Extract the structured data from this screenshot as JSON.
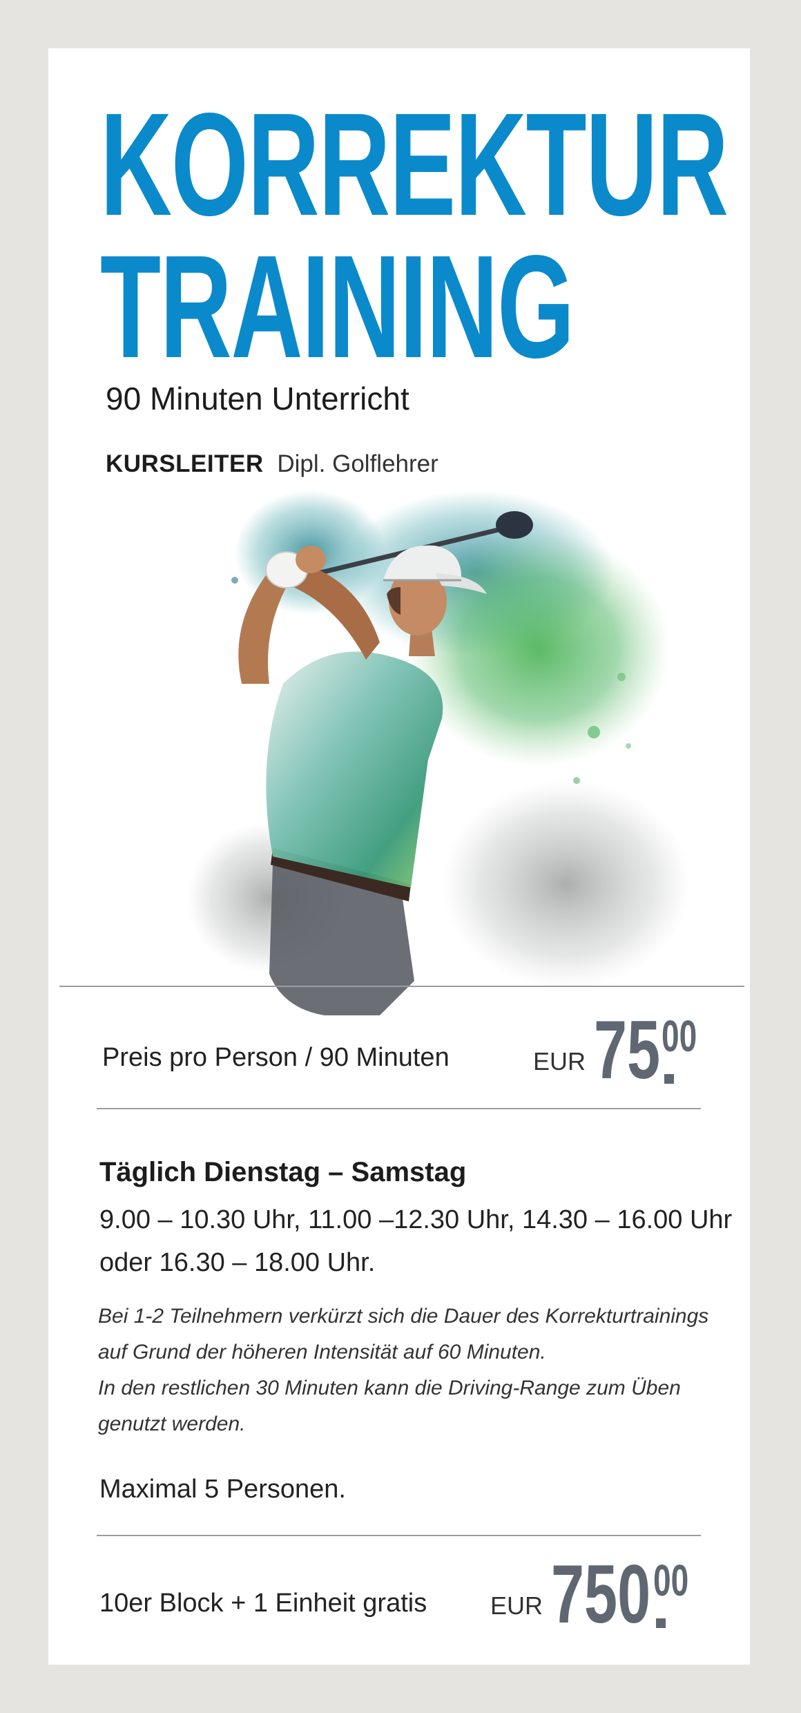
{
  "title": {
    "line1": "KORREKTUR",
    "line2": "TRAINING"
  },
  "subtitle": "90 Minuten Unterricht",
  "course_leader": {
    "label": "KURSLEITER",
    "value": "Dipl. Golflehrer"
  },
  "illustration": {
    "icon": "golfer-watercolor-illustration"
  },
  "price_single": {
    "label": "Preis pro Person / 90 Minuten",
    "currency": "EUR",
    "amount": "75",
    "cents": "00"
  },
  "schedule": {
    "days": "Täglich Dienstag – Samstag",
    "times_line1": "9.00 – 10.30 Uhr, 11.00 –12.30 Uhr, 14.30 – 16.00 Uhr",
    "times_line2": "oder 16.30 – 18.00 Uhr.",
    "note_line1": "Bei 1-2 Teilnehmern verkürzt sich die Dauer des Korrekturtrainings",
    "note_line2": "auf Grund der höheren Intensität auf 60 Minuten.",
    "note_line3": "In den restlichen 30 Minuten kann die Driving-Range zum Üben",
    "note_line4": "genutzt werden.",
    "max": "Maximal 5 Personen."
  },
  "price_block": {
    "label": "10er Block + 1 Einheit gratis",
    "currency": "EUR",
    "amount": "750",
    "cents": "00"
  },
  "colors": {
    "title_blue": "#0a8acb",
    "price_gray": "#5f6772",
    "background": "#e6e4e0"
  }
}
